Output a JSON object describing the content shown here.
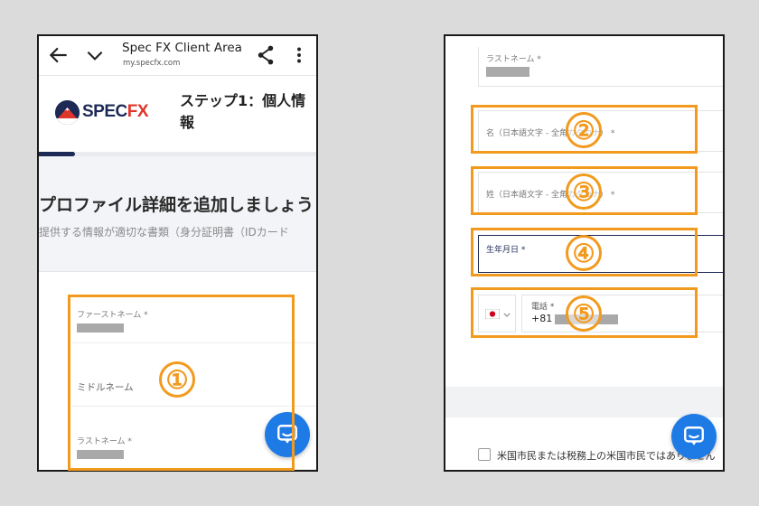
{
  "left_screen": {
    "browser": {
      "title": "Spec FX Client Area",
      "url": "my.specfx.com",
      "back_icon": "arrow-left-icon",
      "tabs_icon": "chevron-down-icon",
      "share_icon": "share-icon",
      "menu_icon": "more-vertical-icon"
    },
    "brand": {
      "logo_prefix": "SPEC",
      "logo_suffix": "FX",
      "logo_color": "#1d2a55",
      "logo_accent": "#e0352b"
    },
    "step_title": "ステップ1：個人情報",
    "progress_percent": 13,
    "profile_heading": "プロファイル詳細を追加しましょう",
    "profile_subtitle": "提供する情報が適切な書類（身分証明書（IDカード",
    "fields": {
      "first_name_label": "ファーストネーム *",
      "middle_name_label": "ミドルネーム",
      "last_name_label": "ラストネーム *"
    },
    "marker": "①"
  },
  "right_screen": {
    "fields": {
      "last_name_label": "ラストネーム *",
      "first_name_kana_label": "名（日本語文字 - 全角カタカナ） *",
      "last_name_kana_label": "姓（日本語文字 - 全角カタカナ） *",
      "birthdate_label": "生年月日 *",
      "phone_label": "電話 *",
      "phone_prefix": "+81",
      "country_flag": "japan-flag-icon"
    },
    "markers": [
      "②",
      "③",
      "④",
      "⑤"
    ],
    "checkbox_label": "米国市民または税務上の米国市民ではありません"
  },
  "colors": {
    "highlight": "#f29a1e",
    "chat": "#1e7be6",
    "brand_navy": "#1d2a55"
  }
}
